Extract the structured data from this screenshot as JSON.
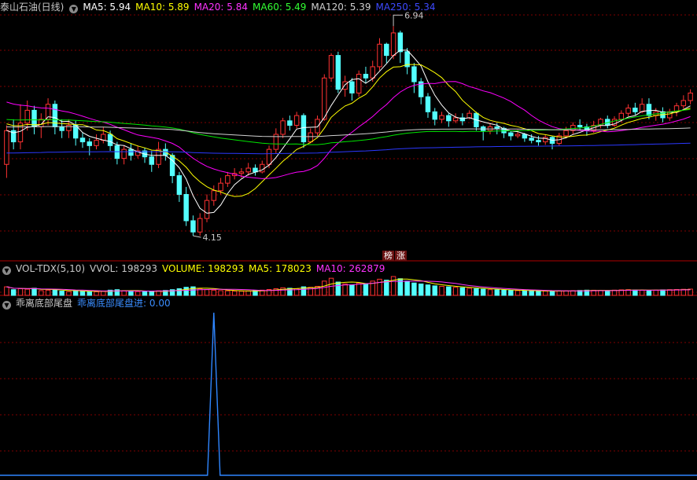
{
  "main_header": {
    "title": "泰山石油(日线)",
    "ma5": "MA5: 5.94",
    "ma10": "MA10: 5.89",
    "ma20": "MA20: 5.84",
    "ma60": "MA60: 5.49",
    "ma120": "MA120: 5.39",
    "ma250": "MA250: 5.34"
  },
  "price_annotations": {
    "high": "6.94",
    "low": "4.15"
  },
  "badges": {
    "b1": "榜",
    "b2": "涨"
  },
  "vol_header": {
    "name": "VOL-TDX(5,10)",
    "vvol": "VVOL: 198293",
    "volume": "VOLUME: 198293",
    "ma5": "MA5: 178023",
    "ma10": "MA10: 262879"
  },
  "ind_header": {
    "name": "乖离底部尾盘",
    "line": "乖离底部尾盘进: 0.00"
  },
  "colors": {
    "up": "#ff3232",
    "down": "#54ffff",
    "ma5": "#ffffff",
    "ma10": "#ffff00",
    "ma20": "#ff00ff",
    "ma60": "#00e600",
    "ma120": "#d0d0d0",
    "ma250": "#2b38ff",
    "grid": "#800000",
    "indicator": "#2f86ff"
  },
  "chart_data": [
    {
      "type": "candlestick",
      "title": "泰山石油(日线)",
      "ylim": [
        3.9,
        7.1
      ],
      "candles": [
        [
          5.1,
          5.55,
          5.62,
          4.92
        ],
        [
          5.55,
          5.4,
          5.7,
          5.3
        ],
        [
          5.4,
          5.65,
          5.9,
          5.3
        ],
        [
          5.65,
          5.82,
          5.95,
          5.55
        ],
        [
          5.82,
          5.6,
          5.88,
          5.5
        ],
        [
          5.6,
          5.7,
          5.78,
          5.45
        ],
        [
          5.7,
          5.9,
          5.98,
          5.62
        ],
        [
          5.9,
          5.6,
          5.95,
          5.5
        ],
        [
          5.6,
          5.55,
          5.7,
          5.45
        ],
        [
          5.55,
          5.62,
          5.7,
          5.45
        ],
        [
          5.62,
          5.45,
          5.68,
          5.35
        ],
        [
          5.45,
          5.4,
          5.52,
          5.32
        ],
        [
          5.4,
          5.35,
          5.45,
          5.22
        ],
        [
          5.35,
          5.42,
          5.5,
          5.3
        ],
        [
          5.42,
          5.5,
          5.6,
          5.38
        ],
        [
          5.5,
          5.35,
          5.55,
          5.28
        ],
        [
          5.35,
          5.18,
          5.4,
          5.1
        ],
        [
          5.18,
          5.3,
          5.35,
          5.1
        ],
        [
          5.3,
          5.22,
          5.38,
          5.15
        ],
        [
          5.22,
          5.28,
          5.35,
          5.18
        ],
        [
          5.28,
          5.2,
          5.32,
          5.12
        ],
        [
          5.2,
          5.1,
          5.28,
          5.0
        ],
        [
          5.1,
          5.3,
          5.4,
          5.05
        ],
        [
          5.3,
          5.22,
          5.38,
          5.15
        ],
        [
          5.22,
          4.95,
          5.25,
          4.85
        ],
        [
          4.95,
          4.7,
          5.0,
          4.6
        ],
        [
          4.7,
          4.35,
          4.8,
          4.28
        ],
        [
          4.35,
          4.2,
          4.42,
          4.15
        ],
        [
          4.2,
          4.38,
          4.45,
          4.15
        ],
        [
          4.38,
          4.62,
          4.7,
          4.33
        ],
        [
          4.62,
          4.75,
          4.82,
          4.55
        ],
        [
          4.75,
          4.85,
          4.92,
          4.7
        ],
        [
          4.85,
          4.95,
          5.0,
          4.8
        ],
        [
          4.95,
          4.98,
          5.05,
          4.9
        ],
        [
          4.98,
          5.0,
          5.05,
          4.92
        ],
        [
          5.0,
          5.05,
          5.12,
          4.95
        ],
        [
          5.05,
          5.0,
          5.1,
          4.95
        ],
        [
          5.0,
          5.1,
          5.15,
          4.98
        ],
        [
          5.1,
          5.3,
          5.35,
          5.05
        ],
        [
          5.3,
          5.5,
          5.58,
          5.25
        ],
        [
          5.5,
          5.68,
          5.72,
          5.45
        ],
        [
          5.68,
          5.62,
          5.75,
          5.55
        ],
        [
          5.62,
          5.75,
          5.8,
          5.58
        ],
        [
          5.75,
          5.4,
          5.78,
          5.32
        ],
        [
          5.4,
          5.52,
          5.58,
          5.38
        ],
        [
          5.52,
          5.7,
          5.75,
          5.48
        ],
        [
          5.7,
          6.25,
          6.3,
          5.68
        ],
        [
          6.25,
          6.55,
          6.58,
          6.2
        ],
        [
          6.55,
          6.1,
          6.6,
          6.05
        ],
        [
          6.1,
          6.2,
          6.28,
          6.0
        ],
        [
          6.2,
          6.05,
          6.25,
          5.95
        ],
        [
          6.05,
          6.3,
          6.35,
          6.0
        ],
        [
          6.3,
          6.25,
          6.4,
          6.18
        ],
        [
          6.25,
          6.4,
          6.48,
          6.2
        ],
        [
          6.4,
          6.7,
          6.78,
          6.35
        ],
        [
          6.7,
          6.55,
          6.72,
          6.45
        ],
        [
          6.55,
          6.85,
          6.94,
          6.5
        ],
        [
          6.85,
          6.6,
          6.88,
          6.45
        ],
        [
          6.6,
          6.4,
          6.65,
          6.3
        ],
        [
          6.4,
          6.2,
          6.45,
          6.05
        ],
        [
          6.2,
          6.0,
          6.25,
          5.9
        ],
        [
          6.0,
          5.8,
          6.05,
          5.72
        ],
        [
          5.8,
          5.7,
          5.85,
          5.62
        ],
        [
          5.7,
          5.75,
          5.8,
          5.65
        ],
        [
          5.75,
          5.68,
          5.78,
          5.6
        ],
        [
          5.68,
          5.72,
          5.78,
          5.65
        ],
        [
          5.72,
          5.68,
          5.78,
          5.62
        ],
        [
          5.72,
          5.78,
          5.82,
          5.7
        ],
        [
          5.78,
          5.6,
          5.8,
          5.55
        ],
        [
          5.6,
          5.55,
          5.62,
          5.42
        ],
        [
          5.55,
          5.6,
          5.65,
          5.5
        ],
        [
          5.6,
          5.58,
          5.65,
          5.5
        ],
        [
          5.58,
          5.52,
          5.6,
          5.45
        ],
        [
          5.52,
          5.48,
          5.55,
          5.42
        ],
        [
          5.48,
          5.5,
          5.56,
          5.45
        ],
        [
          5.5,
          5.45,
          5.52,
          5.4
        ],
        [
          5.45,
          5.42,
          5.5,
          5.38
        ],
        [
          5.42,
          5.4,
          5.48,
          5.35
        ],
        [
          5.4,
          5.46,
          5.5,
          5.36
        ],
        [
          5.46,
          5.38,
          5.48,
          5.3
        ],
        [
          5.38,
          5.48,
          5.52,
          5.35
        ],
        [
          5.48,
          5.55,
          5.6,
          5.45
        ],
        [
          5.55,
          5.62,
          5.66,
          5.5
        ],
        [
          5.62,
          5.6,
          5.7,
          5.55
        ],
        [
          5.6,
          5.55,
          5.64,
          5.48
        ],
        [
          5.55,
          5.62,
          5.68,
          5.52
        ],
        [
          5.62,
          5.7,
          5.72,
          5.58
        ],
        [
          5.7,
          5.62,
          5.75,
          5.58
        ],
        [
          5.62,
          5.7,
          5.74,
          5.6
        ],
        [
          5.7,
          5.78,
          5.82,
          5.66
        ],
        [
          5.78,
          5.85,
          5.9,
          5.74
        ],
        [
          5.85,
          5.8,
          5.92,
          5.76
        ],
        [
          5.8,
          5.9,
          5.98,
          5.78
        ],
        [
          5.9,
          5.75,
          5.98,
          5.7
        ],
        [
          5.75,
          5.8,
          5.85,
          5.68
        ],
        [
          5.8,
          5.72,
          5.86,
          5.66
        ],
        [
          5.72,
          5.8,
          5.84,
          5.68
        ],
        [
          5.8,
          5.88,
          5.92,
          5.74
        ],
        [
          5.88,
          5.95,
          6.02,
          5.84
        ],
        [
          5.95,
          6.05,
          6.1,
          5.9
        ]
      ],
      "moving_averages": [
        "MA5",
        "MA10",
        "MA20",
        "MA60",
        "MA120",
        "MA250"
      ],
      "annotated_high": 6.94,
      "annotated_low": 4.15
    },
    {
      "type": "bar",
      "title": "VOL-TDX(5,10)",
      "values": [
        90,
        60,
        70,
        65,
        75,
        50,
        55,
        60,
        45,
        40,
        50,
        45,
        40,
        38,
        42,
        55,
        60,
        50,
        45,
        40,
        38,
        42,
        48,
        52,
        60,
        70,
        85,
        90,
        70,
        60,
        55,
        50,
        48,
        45,
        44,
        46,
        50,
        55,
        62,
        70,
        80,
        75,
        70,
        90,
        85,
        95,
        150,
        180,
        140,
        120,
        110,
        130,
        120,
        150,
        170,
        160,
        198,
        175,
        150,
        130,
        120,
        110,
        100,
        95,
        90,
        85,
        80,
        75,
        70,
        65,
        60,
        58,
        55,
        52,
        50,
        48,
        47,
        46,
        45,
        44,
        46,
        48,
        50,
        52,
        55,
        54,
        52,
        50,
        55,
        58,
        60,
        56,
        54,
        52,
        55,
        58,
        60,
        62,
        64,
        66
      ],
      "ma5": 178023,
      "ma10": 262879
    },
    {
      "type": "line",
      "title": "乖离底部尾盘",
      "series": [
        {
          "name": "乖离底部尾盘进",
          "spike_index": 30,
          "spike_value": 1,
          "baseline": 0
        }
      ]
    }
  ]
}
